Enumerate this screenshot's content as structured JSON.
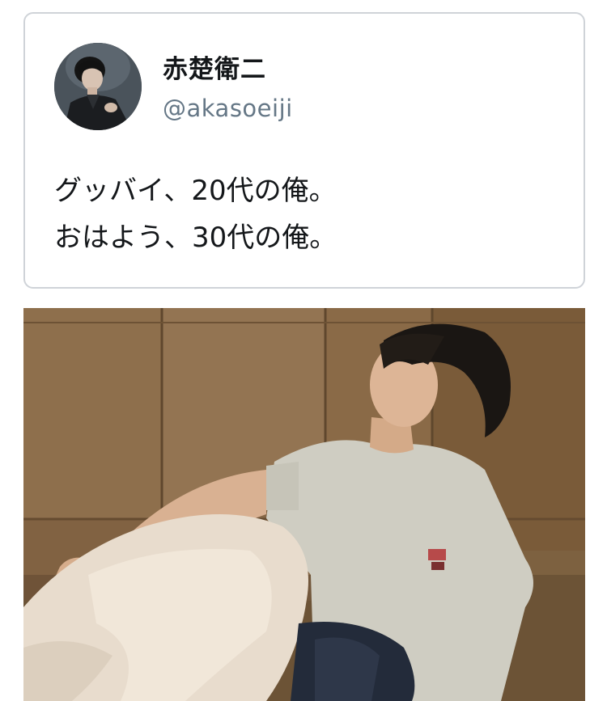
{
  "tweet": {
    "display_name": "赤楚衛二",
    "handle": "@akasoeiji",
    "text_lines": [
      "グッバイ、20代の俺。",
      "おはよう、30代の俺。"
    ]
  },
  "icons": {
    "avatar": "profile-photo",
    "photo": "attached-photo"
  },
  "colors": {
    "name": "#14171a",
    "handle": "#657786",
    "border": "#cfd3d8"
  }
}
